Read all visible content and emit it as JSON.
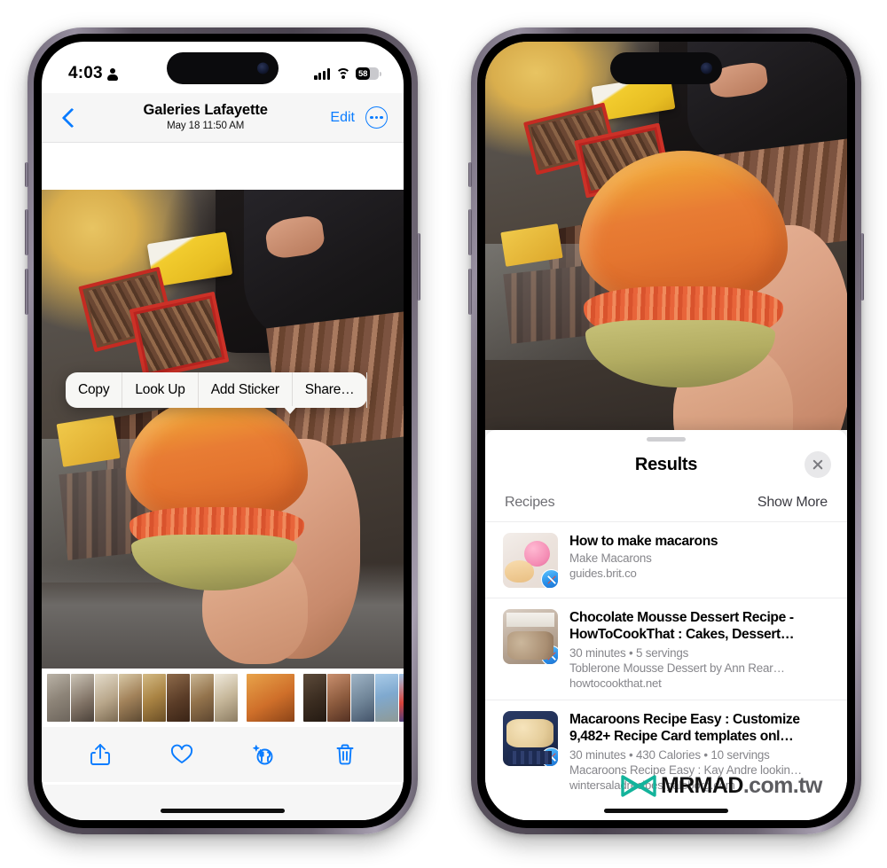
{
  "left_phone": {
    "status_bar": {
      "time": "4:03",
      "person_icon": "person-icon",
      "cellular_icon": "cellular-bars-icon",
      "wifi_icon": "wifi-icon",
      "battery_percent": "58"
    },
    "nav_bar": {
      "back_icon": "chevron-left-icon",
      "title": "Galeries Lafayette",
      "subtitle": "May 18  11:50 AM",
      "edit_label": "Edit",
      "more_icon": "ellipsis-circle-icon"
    },
    "context_menu": {
      "items": [
        {
          "label": "Copy",
          "name": "menu-item-copy"
        },
        {
          "label": "Look Up",
          "name": "menu-item-look-up"
        },
        {
          "label": "Add Sticker",
          "name": "menu-item-add-sticker"
        },
        {
          "label": "Share…",
          "name": "menu-item-share"
        }
      ]
    },
    "thumbnail_strip": [
      "ph1",
      "ph2",
      "ph3",
      "ph4",
      "ph5",
      "ph6",
      "ph7",
      "ph8",
      "ph9",
      "ph10",
      "ph11",
      "ph12",
      "ph13",
      "ph14",
      "ph15",
      "ph16",
      "ph17"
    ],
    "toolbar": {
      "share_icon": "share-icon",
      "favorite_icon": "heart-icon",
      "visual_lookup_icon": "visual-lookup-food-icon",
      "delete_icon": "trash-icon"
    }
  },
  "right_phone": {
    "sheet": {
      "grabber": "sheet-grabber",
      "title": "Results",
      "close_icon": "close-icon",
      "section": {
        "label": "Recipes",
        "show_more": "Show More"
      },
      "results": [
        {
          "title": "How to make macarons",
          "meta": "",
          "description": "Make Macarons",
          "url": "guides.brit.co",
          "thumb_class": "rp1",
          "badge": "safari-icon"
        },
        {
          "title": "Chocolate Mousse Dessert Recipe - HowToCookThat : Cakes, Dessert…",
          "meta": "30 minutes • 5 servings",
          "description": "Toblerone Mousse Dessert by Ann Rear…",
          "url": "howtocookthat.net",
          "thumb_class": "rp2",
          "badge": "safari-icon"
        },
        {
          "title": "Macaroons Recipe Easy : Customize 9,482+ Recipe Card templates onl…",
          "meta": "30 minutes • 430 Calories • 10 servings",
          "description": "Macaroons Recipe Easy : Kay Andre lookin…",
          "url": "wintersaladrecipes.galeborg.com",
          "thumb_class": "rp3",
          "badge": "safari-icon"
        }
      ]
    }
  },
  "watermark": {
    "brand": "MRMAD",
    "domain": ".com.tw",
    "logo_icon": "mrmad-bowtie-logo-icon",
    "logo_color": "#13B39B"
  },
  "colors": {
    "ios_blue": "#0a7cff",
    "sheet_bg": "#ffffff",
    "nav_bg": "#f6f6f6",
    "secondary_text": "#86868b",
    "frame": "#5b5460"
  }
}
